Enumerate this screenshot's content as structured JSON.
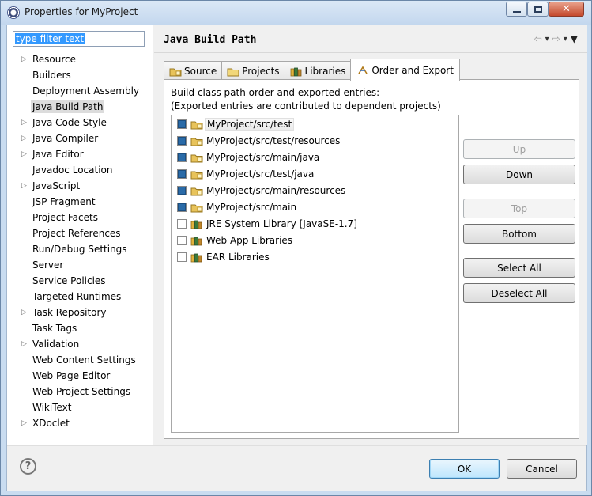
{
  "window": {
    "title": "Properties for MyProject",
    "controls": {
      "minimize_icon": "minimize-icon",
      "maximize_icon": "maximize-icon",
      "close_icon": "close-icon"
    }
  },
  "sidebar": {
    "filter_value": "type filter text",
    "items": [
      {
        "label": "Resource",
        "expandable": true
      },
      {
        "label": "Builders",
        "expandable": false
      },
      {
        "label": "Deployment Assembly",
        "expandable": false
      },
      {
        "label": "Java Build Path",
        "expandable": false,
        "selected": true
      },
      {
        "label": "Java Code Style",
        "expandable": true
      },
      {
        "label": "Java Compiler",
        "expandable": true
      },
      {
        "label": "Java Editor",
        "expandable": true
      },
      {
        "label": "Javadoc Location",
        "expandable": false
      },
      {
        "label": "JavaScript",
        "expandable": true
      },
      {
        "label": "JSP Fragment",
        "expandable": false
      },
      {
        "label": "Project Facets",
        "expandable": false
      },
      {
        "label": "Project References",
        "expandable": false
      },
      {
        "label": "Run/Debug Settings",
        "expandable": false
      },
      {
        "label": "Server",
        "expandable": false
      },
      {
        "label": "Service Policies",
        "expandable": false
      },
      {
        "label": "Targeted Runtimes",
        "expandable": false
      },
      {
        "label": "Task Repository",
        "expandable": true
      },
      {
        "label": "Task Tags",
        "expandable": false
      },
      {
        "label": "Validation",
        "expandable": true
      },
      {
        "label": "Web Content Settings",
        "expandable": false
      },
      {
        "label": "Web Page Editor",
        "expandable": false
      },
      {
        "label": "Web Project Settings",
        "expandable": false
      },
      {
        "label": "WikiText",
        "expandable": false
      },
      {
        "label": "XDoclet",
        "expandable": true
      }
    ]
  },
  "main": {
    "title": "Java Build Path",
    "tabs": [
      {
        "label": "Source",
        "icon": "source-folder-icon"
      },
      {
        "label": "Projects",
        "icon": "projects-icon"
      },
      {
        "label": "Libraries",
        "icon": "libraries-icon"
      },
      {
        "label": "Order and Export",
        "icon": "order-export-icon",
        "active": true
      }
    ],
    "description_line1": "Build class path order and exported entries:",
    "description_line2": "(Exported entries are contributed to dependent projects)",
    "entries": [
      {
        "label": "MyProject/src/test",
        "checked": true,
        "icon": "source-folder-icon",
        "highlighted": true
      },
      {
        "label": "MyProject/src/test/resources",
        "checked": true,
        "icon": "source-folder-icon"
      },
      {
        "label": "MyProject/src/main/java",
        "checked": true,
        "icon": "source-folder-icon"
      },
      {
        "label": "MyProject/src/test/java",
        "checked": true,
        "icon": "source-folder-icon"
      },
      {
        "label": "MyProject/src/main/resources",
        "checked": true,
        "icon": "source-folder-icon"
      },
      {
        "label": "MyProject/src/main",
        "checked": true,
        "icon": "source-folder-icon"
      },
      {
        "label": "JRE System Library [JavaSE-1.7]",
        "checked": false,
        "icon": "library-icon"
      },
      {
        "label": "Web App Libraries",
        "checked": false,
        "icon": "library-icon"
      },
      {
        "label": "EAR Libraries",
        "checked": false,
        "icon": "library-icon"
      }
    ],
    "buttons": {
      "up": "Up",
      "down": "Down",
      "top": "Top",
      "bottom": "Bottom",
      "select_all": "Select All",
      "deselect_all": "Deselect All"
    }
  },
  "footer": {
    "help_symbol": "?",
    "ok": "OK",
    "cancel": "Cancel"
  },
  "colors": {
    "selection": "#3399ff",
    "checkbox_on": "#2a6ba8",
    "ok_button_border": "#3c7fb1"
  }
}
